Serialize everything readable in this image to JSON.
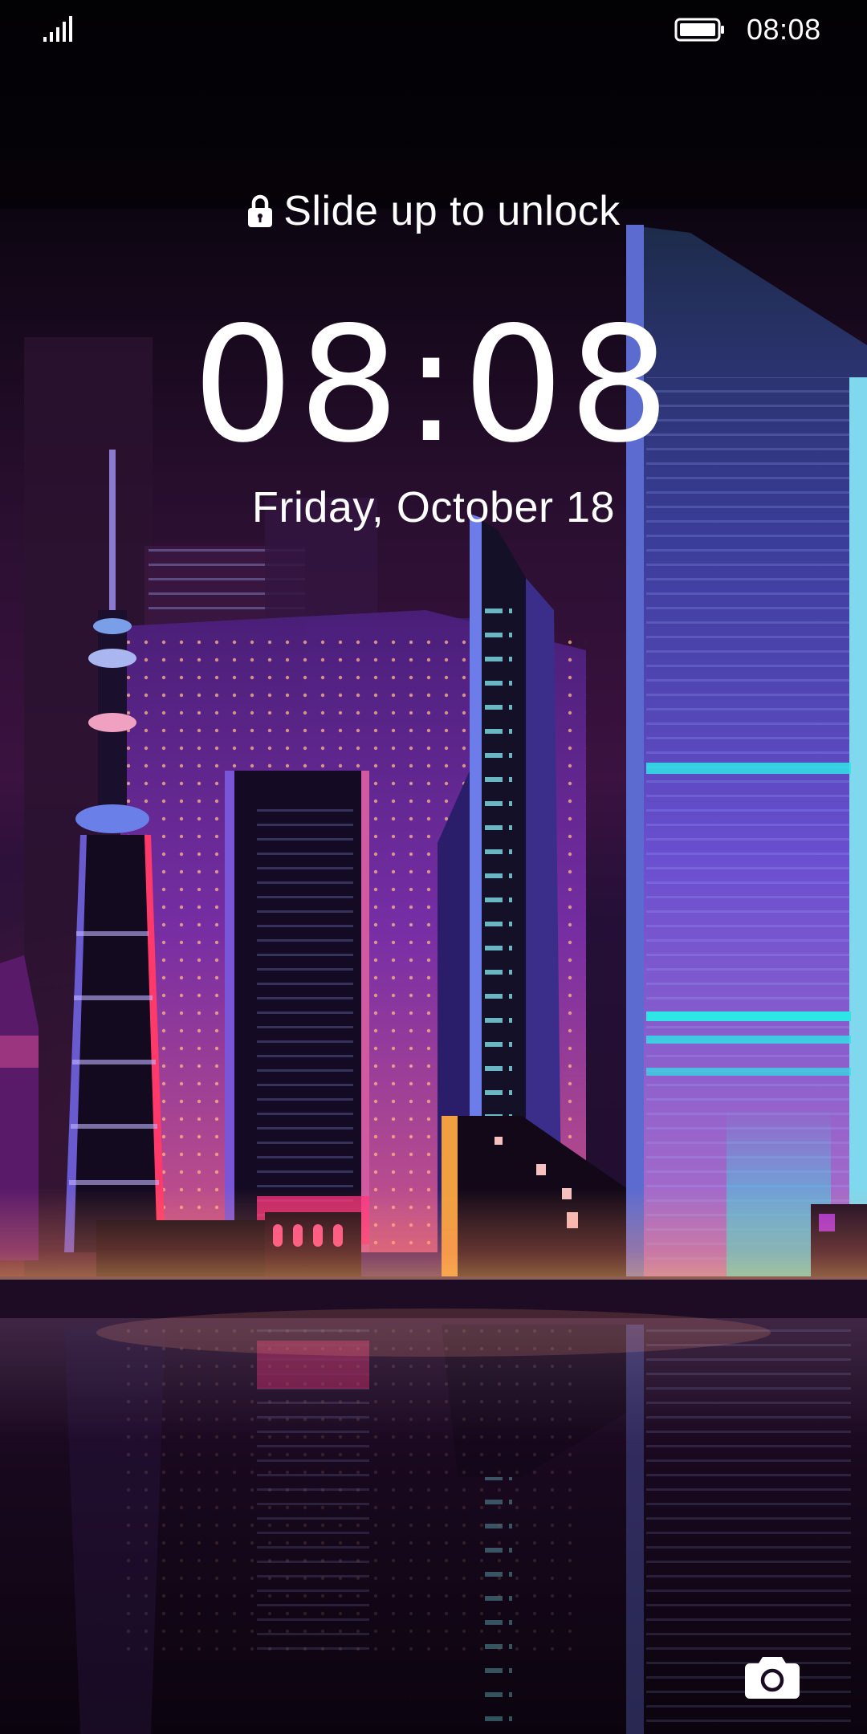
{
  "status_bar": {
    "time": "08:08",
    "signal_icon": "signal-bars-icon",
    "battery_icon": "battery-full-icon"
  },
  "lock_screen": {
    "unlock_hint": "Slide up to unlock",
    "lock_icon": "padlock-icon",
    "clock": "08:08",
    "date": "Friday, October 18",
    "camera_icon": "camera-icon"
  },
  "wallpaper": {
    "theme": "neon city skyline at night with water reflection",
    "colors": {
      "sky_top": "#060309",
      "sky_mid": "#2a0f3a",
      "horizon_glow": "#ff7a6a",
      "neon_purple": "#7a3bd8",
      "neon_cyan": "#2ee6e6",
      "neon_pink": "#ff2f7d",
      "water": "#120616"
    }
  }
}
